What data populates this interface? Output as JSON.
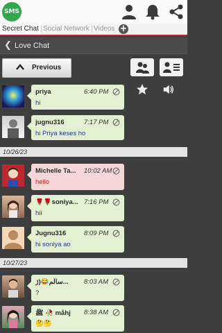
{
  "app": {
    "logo_text": "SMS"
  },
  "header_icons": [
    "person-icon",
    "bell-icon",
    "share-icon"
  ],
  "tabs": [
    {
      "label": "Secret Chat",
      "active": true
    },
    {
      "label": "Social Network",
      "active": false
    },
    {
      "label": "Videos",
      "active": false
    }
  ],
  "chat": {
    "title": "Love Chat"
  },
  "toolbar": {
    "previous_label": "Previous"
  },
  "groups": [
    {
      "date": "",
      "messages": [
        {
          "sender": "priya",
          "time": "6:40 PM",
          "text": "hi",
          "color": "green"
        },
        {
          "sender": "jugnu316",
          "time": "7:17 PM",
          "text": "hi Priya keses ho",
          "color": "green"
        }
      ]
    },
    {
      "date": "10/26/23",
      "messages": [
        {
          "sender": "Michelle Ta...",
          "time": "10:02 AM",
          "text": "hello",
          "color": "pink"
        },
        {
          "sender": "🌹🌹soniya...",
          "time": "7:16 PM",
          "text": "hii",
          "color": "green"
        },
        {
          "sender": "Jugnu316",
          "time": "8:09 PM",
          "text": "hi soniya ao",
          "color": "green"
        }
      ]
    },
    {
      "date": "10/27/23",
      "messages": [
        {
          "sender": "سالم😂(ژ...",
          "time": "8:03 AM",
          "text": "?",
          "color": "green"
        },
        {
          "sender": "ﷺ 🥀 måhj",
          "time": "8:38 AM",
          "text": "🤔🤔",
          "color": "green"
        }
      ]
    }
  ],
  "colors": {
    "accent": "#c0262e",
    "bubble_green": "#e4f0d2",
    "bubble_pink": "#f5d7d7",
    "brand_green": "#2ea84a"
  }
}
